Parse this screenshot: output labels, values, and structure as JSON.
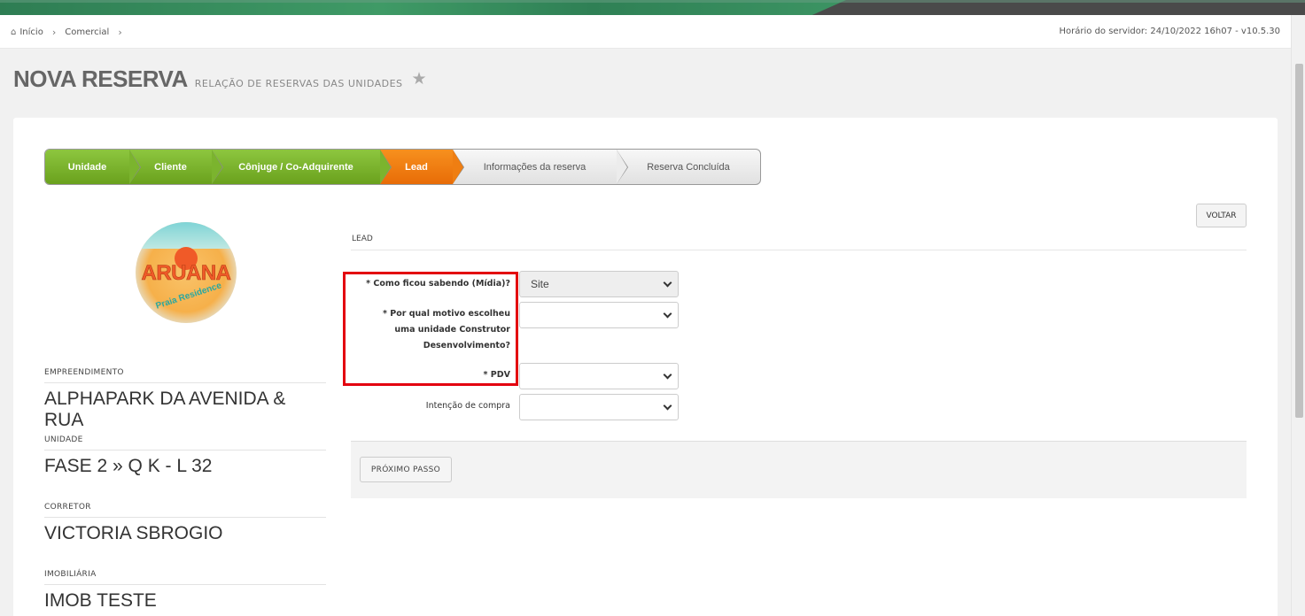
{
  "breadcrumb": {
    "items": [
      "Início",
      "Comercial"
    ]
  },
  "server_time": "Horário do servidor: 24/10/2022 16h07 - v10.5.30",
  "page": {
    "title": "NOVA RESERVA",
    "subtitle": "RELAÇÃO DE RESERVAS DAS UNIDADES"
  },
  "wizard": {
    "steps": [
      {
        "label": "Unidade",
        "state": "done"
      },
      {
        "label": "Cliente",
        "state": "done"
      },
      {
        "label": "Cônjuge / Co-Adquirente",
        "state": "done"
      },
      {
        "label": "Lead",
        "state": "active"
      },
      {
        "label": "Informações da reserva",
        "state": "todo"
      },
      {
        "label": "Reserva Concluída",
        "state": "todo"
      }
    ]
  },
  "logo": {
    "word": "ARUANA",
    "tagline": "Praia Residence"
  },
  "details": {
    "empreendimento_label": "EMPREENDIMENTO",
    "empreendimento": "ALPHAPARK DA AVENIDA & RUA",
    "unidade_label": "UNIDADE",
    "unidade": "FASE 2 » Q K - L 32",
    "corretor_label": "CORRETOR",
    "corretor": "VICTORIA SBROGIO",
    "imobiliaria_label": "IMOBILIÁRIA",
    "imobiliaria": "IMOB TESTE"
  },
  "actions": {
    "voltar": "VOLTAR",
    "proximo": "PRÓXIMO PASSO"
  },
  "form": {
    "section": "LEAD",
    "midia_label": "* Como ficou sabendo (Mídia)?",
    "midia_value": "Site",
    "motivo_label_1": "* Por qual motivo escolheu",
    "motivo_label_2": "uma unidade Construtor",
    "motivo_label_3": "Desenvolvimento?",
    "motivo_value": "",
    "pdv_label": "* PDV",
    "pdv_value": "",
    "intencao_label": "Intenção de compra",
    "intencao_value": ""
  },
  "colors": {
    "step_done": "#7bb42e",
    "step_active": "#ef7e12",
    "highlight": "#e3000f"
  }
}
